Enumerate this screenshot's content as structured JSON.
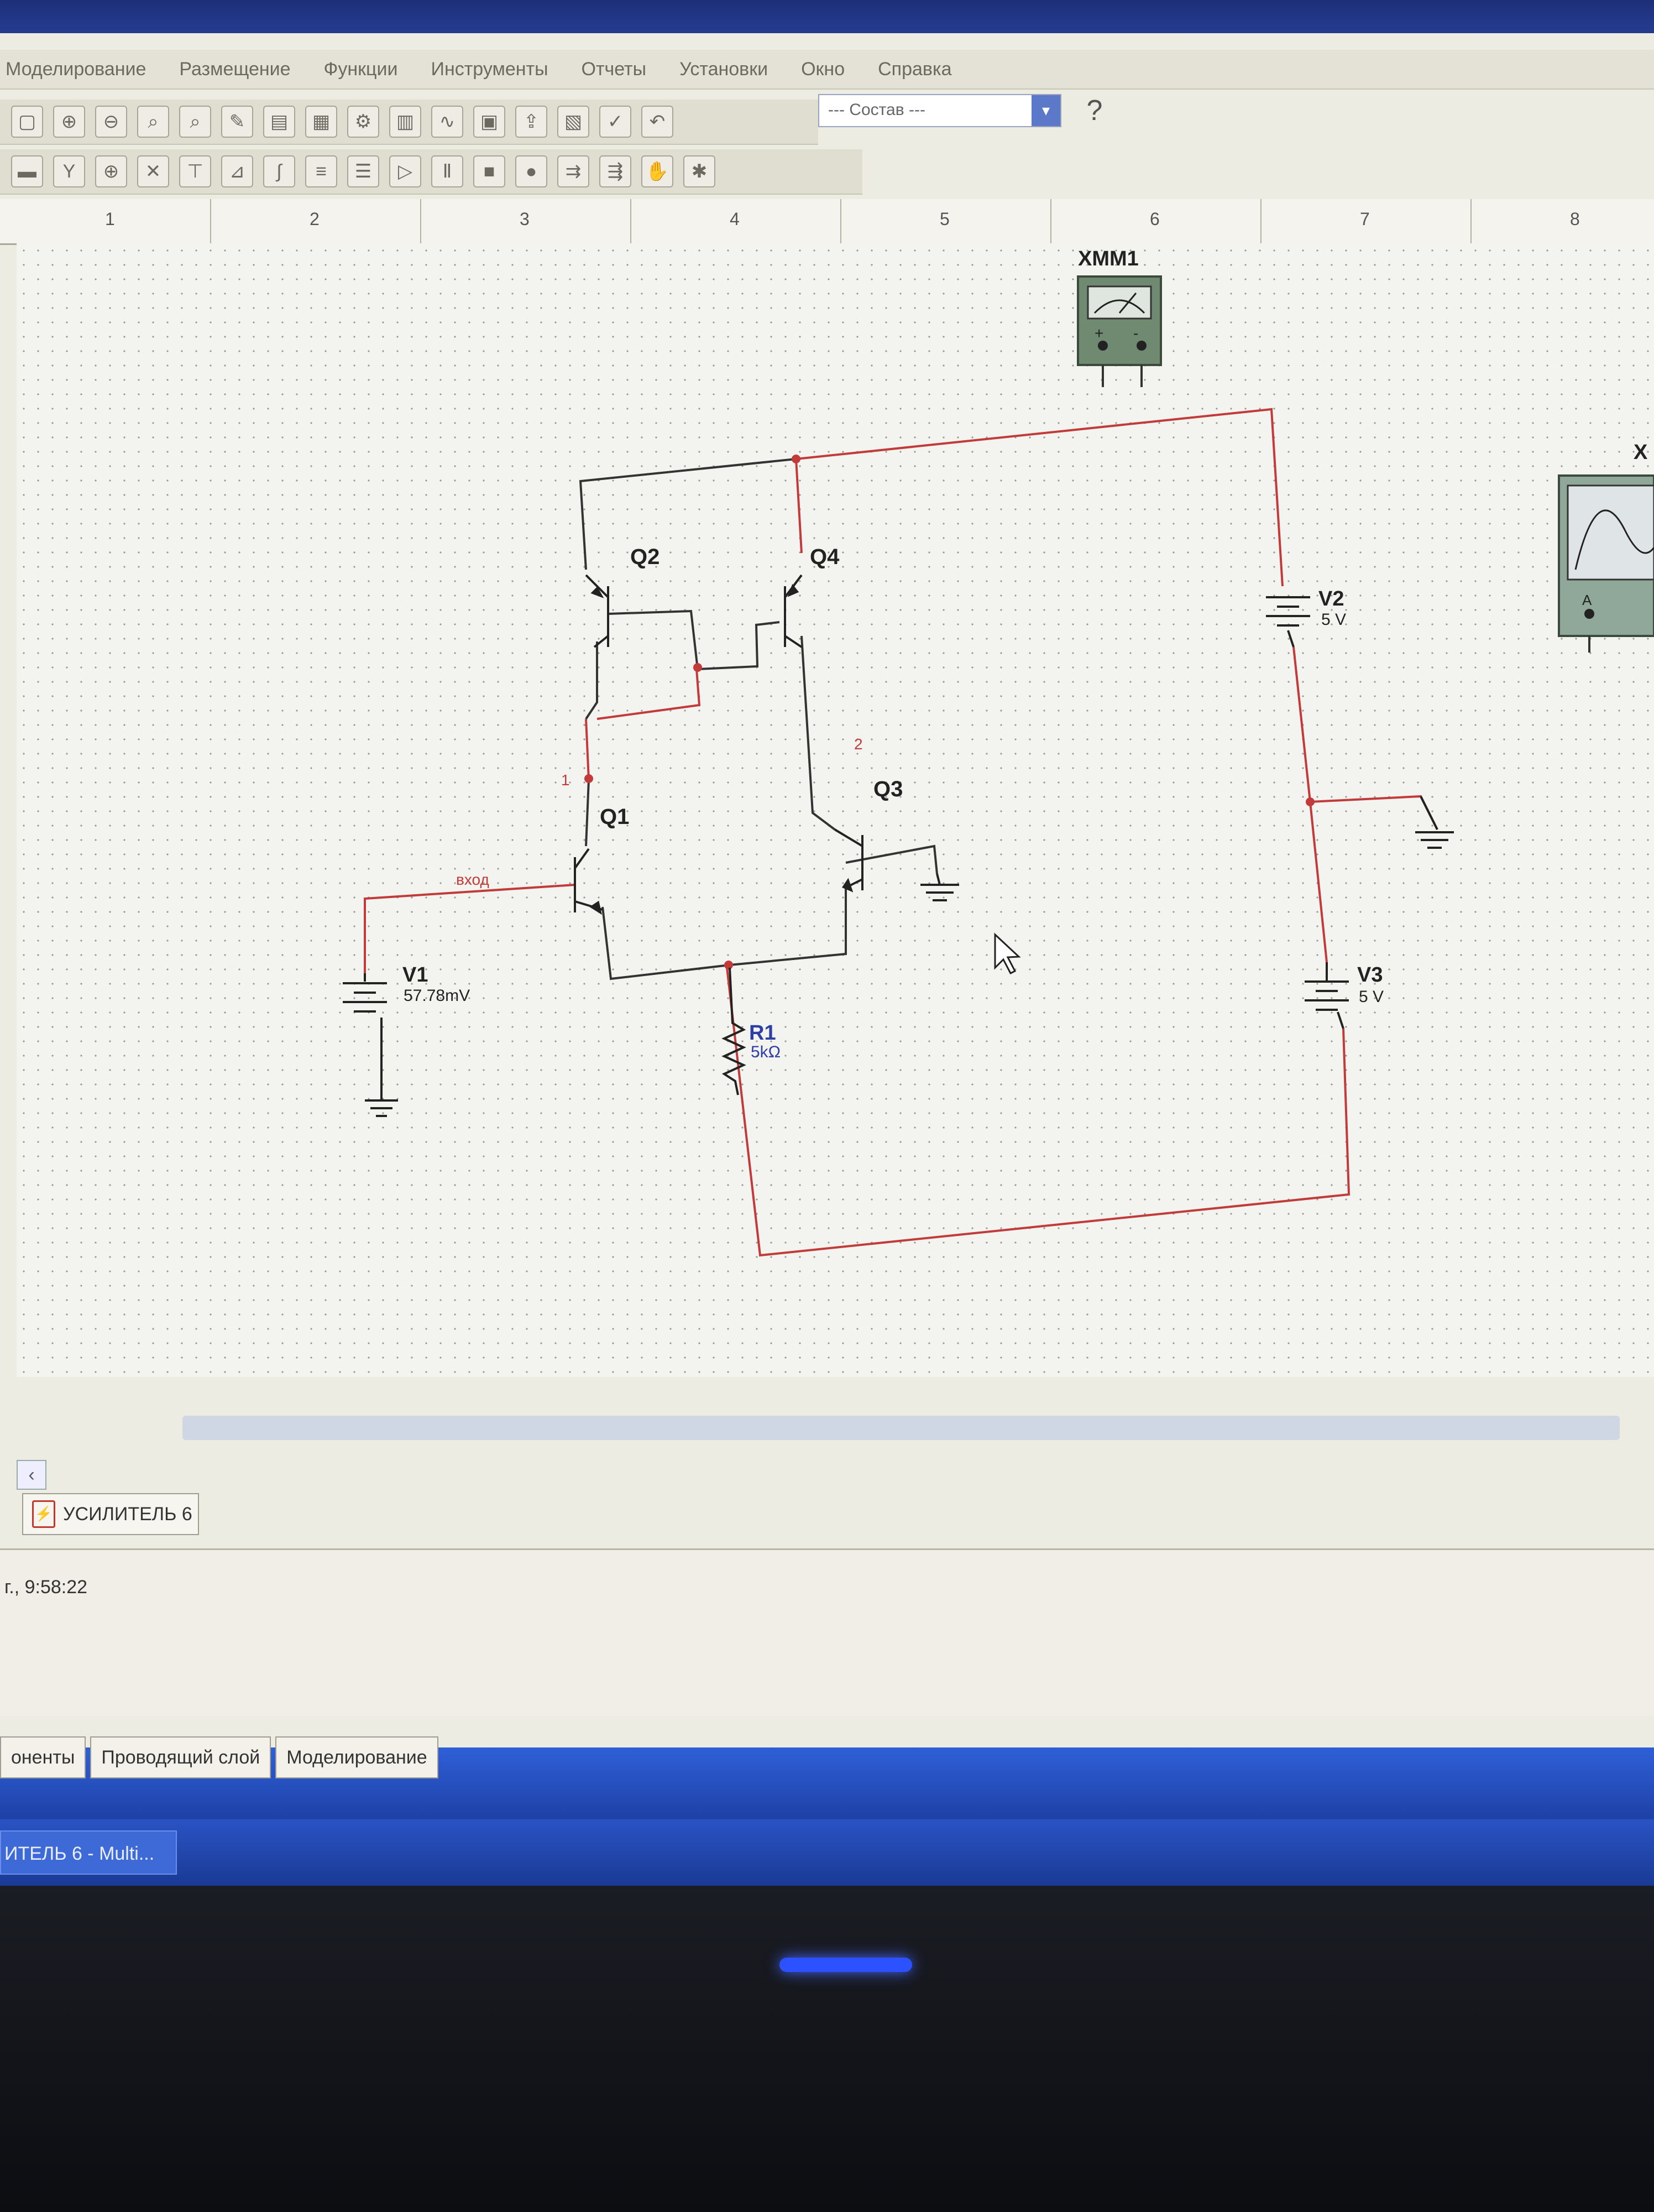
{
  "app": {
    "menus": [
      "Моделирование",
      "Размещение",
      "Функции",
      "Инструменты",
      "Отчеты",
      "Установки",
      "Окно",
      "Справка"
    ],
    "component_combo": "--- Состав ---",
    "help_icon": "question-icon"
  },
  "ruler": {
    "labels": [
      "1",
      "2",
      "3",
      "4",
      "5",
      "6",
      "7",
      "8"
    ]
  },
  "instruments": {
    "multimeter_label": "XMM1",
    "multimeter_terminals": [
      "+",
      "-"
    ],
    "oscilloscope_label": "X",
    "oscilloscope_terminal": "A"
  },
  "schematic": {
    "transistors": [
      "Q1",
      "Q2",
      "Q3",
      "Q4"
    ],
    "v1": {
      "label": "V1",
      "value": "57.78mV"
    },
    "v2": {
      "label": "V2",
      "value": "5 V"
    },
    "v3": {
      "label": "V3",
      "value": "5 V"
    },
    "r1": {
      "label": "R1",
      "value": "5kΩ"
    },
    "net_input": "вход",
    "net1": "1",
    "net2": "2"
  },
  "sheet_tab": "УСИЛИТЕЛЬ 6",
  "log": {
    "line": "г., 9:58:22"
  },
  "bottom_tabs": [
    "оненты",
    "Проводящий слой",
    "Моделирование"
  ],
  "taskbar": {
    "item": "ИТЕЛЬ 6 - Multi..."
  },
  "colors": {
    "wire_red": "#c23a3a",
    "wire_dark": "#333333",
    "taskbar_blue": "#2a53c4"
  }
}
